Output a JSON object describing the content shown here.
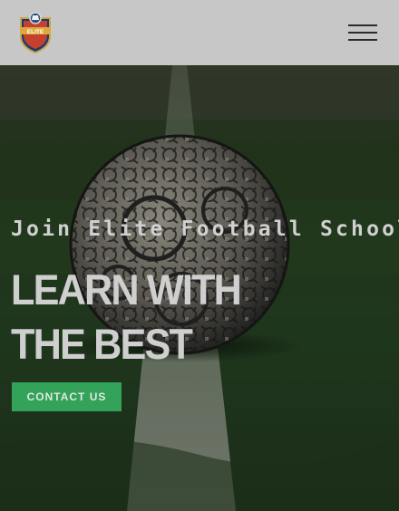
{
  "header": {
    "logo_text": "ELITE",
    "menu_icon": "hamburger-menu-icon"
  },
  "hero": {
    "kicker": "Join Elite Football Schools",
    "headline": "LEARN WITH THE BEST",
    "cta_label": "CONTACT US"
  },
  "colors": {
    "header_bg": "#c7c7c7",
    "cta_green": "#33a35a",
    "grass": "#2f4a2c"
  }
}
